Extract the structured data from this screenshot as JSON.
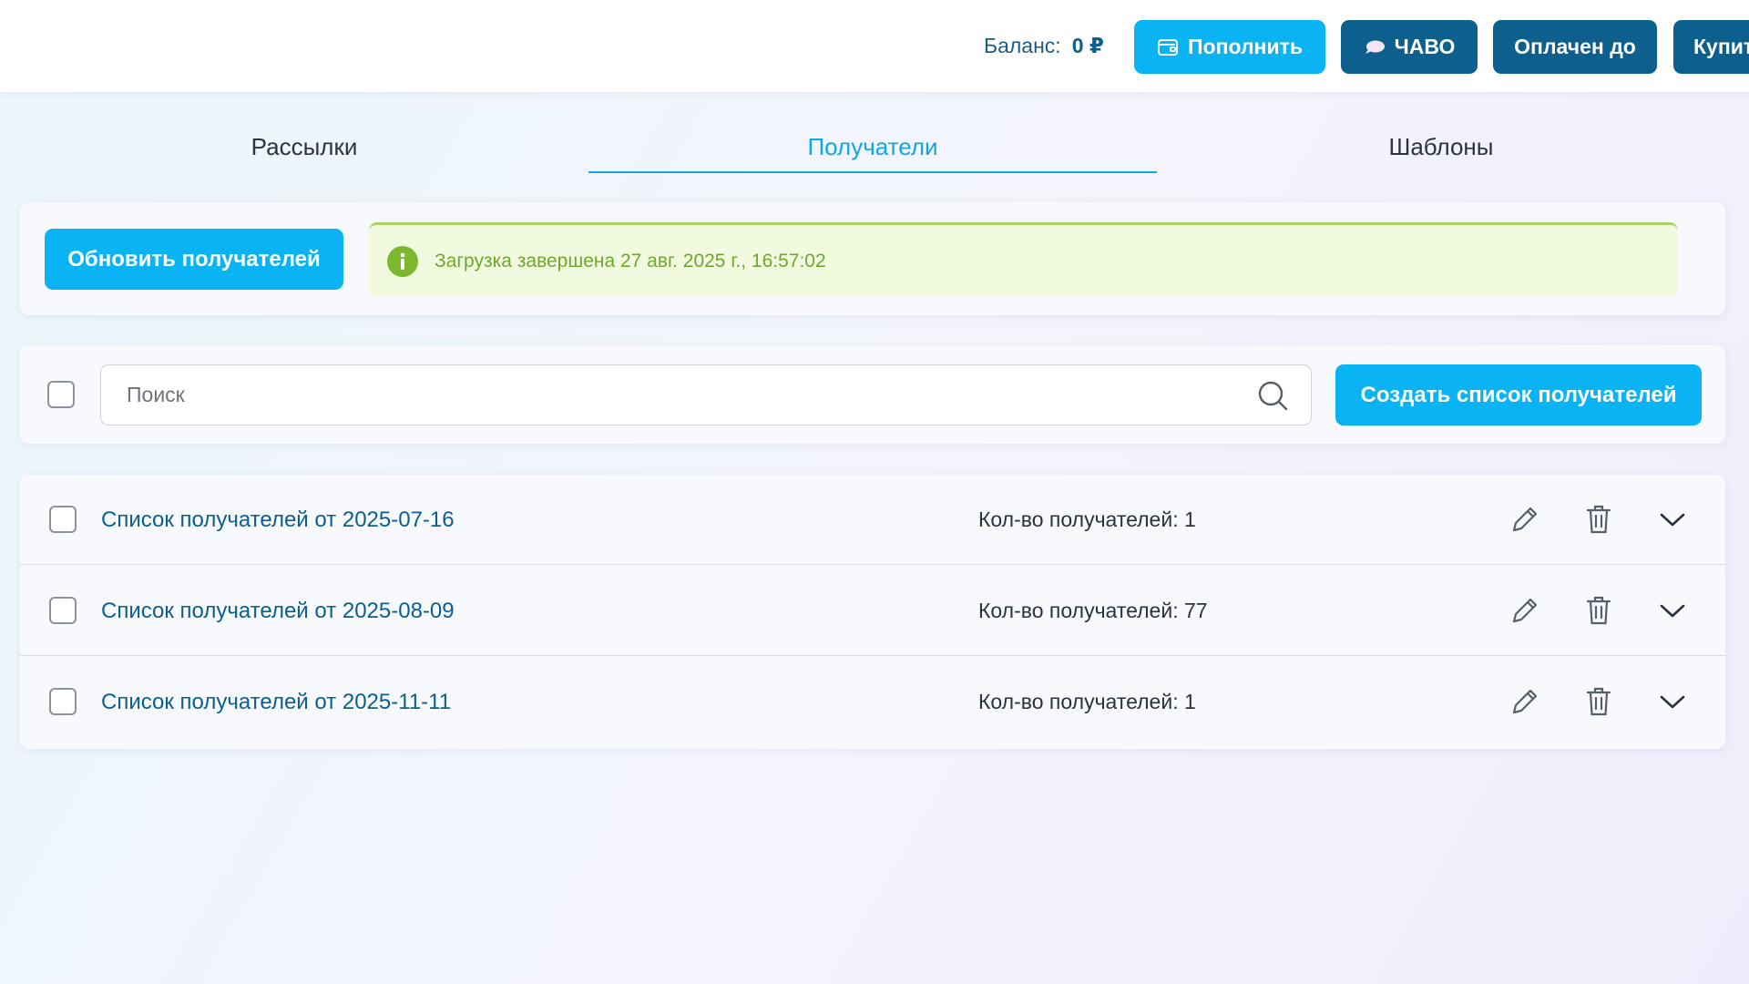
{
  "header": {
    "balance_label": "Баланс:",
    "balance_value": "0 ₽",
    "buttons": {
      "topup": "Пополнить",
      "faq": "ЧАВО",
      "paid_until": "Оплачен до",
      "buy": "Купить"
    }
  },
  "tabs": [
    {
      "label": "Рассылки",
      "active": false
    },
    {
      "label": "Получатели",
      "active": true
    },
    {
      "label": "Шаблоны",
      "active": false
    }
  ],
  "refresh": {
    "button_label": "Обновить получателей",
    "status_text": "Загрузка завершена 27 авг. 2025 г., 16:57:02"
  },
  "search": {
    "placeholder": "Поиск",
    "value": "",
    "create_button_label": "Создать список получателей"
  },
  "lists": [
    {
      "name": "Список получателей от 2025-07-16",
      "count_text": "Кол-во получателей: 1"
    },
    {
      "name": "Список получателей от 2025-08-09",
      "count_text": "Кол-во получателей: 77"
    },
    {
      "name": "Список получателей от 2025-11-11",
      "count_text": "Кол-во получателей: 1"
    }
  ],
  "colors": {
    "primary": "#09b3f4",
    "dark": "#0d5f8d",
    "success_bg": "#f1fadf",
    "success_text": "#6ea82c"
  },
  "icons": {
    "topup": "wallet-icon",
    "faq": "chat-bubble-icon",
    "alert": "info-icon",
    "search": "search-icon",
    "edit": "pencil-icon",
    "delete": "trash-icon",
    "expand": "chevron-down-icon"
  }
}
